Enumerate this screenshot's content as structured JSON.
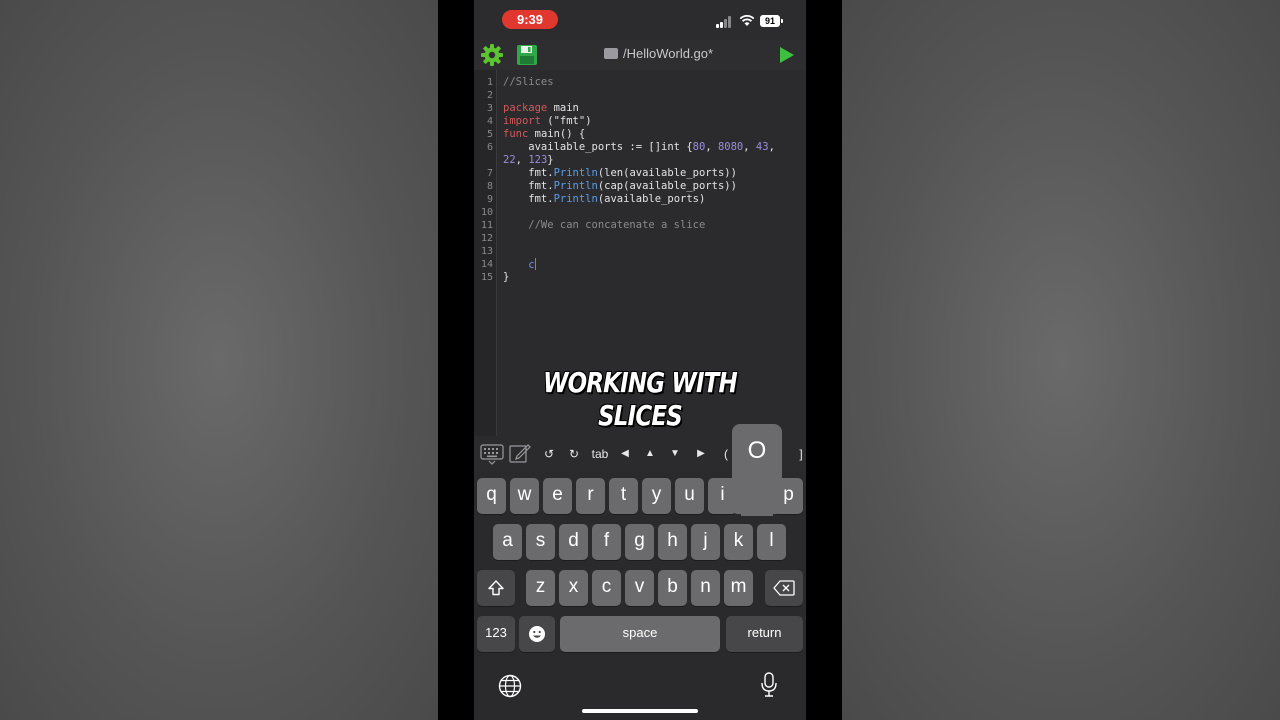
{
  "status_bar": {
    "time": "9:39",
    "battery": "91"
  },
  "toolbar": {
    "file_title": "/HelloWorld.go*",
    "settings_icon": "gear-icon",
    "save_icon": "floppy-disk-icon",
    "run_icon": "play-icon"
  },
  "editor": {
    "line_numbers": [
      "1",
      "2",
      "3",
      "4",
      "5",
      "6",
      "",
      "7",
      "8",
      "9",
      "10",
      "11",
      "12",
      "13",
      "14",
      "15"
    ],
    "lines": {
      "l1": "//Slices",
      "l3_kw": "package",
      "l3_rest": " main",
      "l4_kw": "import",
      "l4_rest": " (\"fmt\")",
      "l5_kw": "func",
      "l5_rest": " main() {",
      "l6_a": "    available_ports := []int {",
      "l6_n1": "80",
      "l6_c1": ", ",
      "l6_n2": "8080",
      "l6_c2": ", ",
      "l6_n3": "43",
      "l6_c3": ",",
      "l6b_n4": "22",
      "l6b_c4": ", ",
      "l6b_n5": "123",
      "l6b_end": "}",
      "l7_a": "    fmt.",
      "l7_fn": "Println",
      "l7_rest": "(len(available_ports))",
      "l8_a": "    fmt.",
      "l8_fn": "Println",
      "l8_rest": "(cap(available_ports))",
      "l9_a": "    fmt.",
      "l9_fn": "Println",
      "l9_rest": "(available_ports)",
      "l11": "    //We can concatenate a slice",
      "l14_indent": "    ",
      "l14_typed": "c",
      "l15": "}"
    }
  },
  "caption": "WORKING WITH SLICES",
  "accessory_bar": {
    "keyboard_icon": "keyboard-icon",
    "edit_icon": "pencil-note-icon",
    "undo": "↺",
    "redo": "↻",
    "tab": "tab",
    "left": "◀",
    "up": "▲",
    "down": "▼",
    "right": "▶",
    "paren_open": "(",
    "bracket_close": "]"
  },
  "keyboard": {
    "row1": [
      "q",
      "w",
      "e",
      "r",
      "t",
      "y",
      "u",
      "i",
      "o",
      "p"
    ],
    "row2": [
      "a",
      "s",
      "d",
      "f",
      "g",
      "h",
      "j",
      "k",
      "l"
    ],
    "row3": [
      "z",
      "x",
      "c",
      "v",
      "b",
      "n",
      "m"
    ],
    "popup_letter": "O",
    "numbers_label": "123",
    "space_label": "space",
    "return_label": "return"
  }
}
